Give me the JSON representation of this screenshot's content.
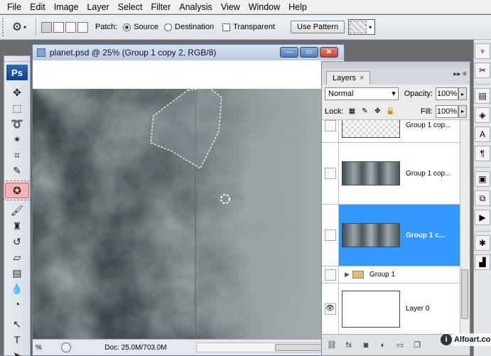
{
  "menu": [
    "File",
    "Edit",
    "Image",
    "Layer",
    "Select",
    "Filter",
    "Analysis",
    "View",
    "Window",
    "Help"
  ],
  "options_bar": {
    "patch_label": "Patch:",
    "source_label": "Source",
    "destination_label": "Destination",
    "transparent_label": "Transparent",
    "use_pattern_label": "Use Pattern",
    "selected_patch_mode": "Source"
  },
  "toolbox": {
    "logo": "Ps",
    "active_tool": "patch-tool"
  },
  "document": {
    "title": "planet.psd @ 25% (Group 1 copy 2, RGB/8)",
    "zoom_readout": "%",
    "doc_size": "Doc: 25.0M/703.0M"
  },
  "layers_panel": {
    "tab_label": "Layers",
    "blend_mode": "Normal",
    "opacity_label": "Opacity:",
    "opacity_value": "100%",
    "lock_label": "Lock:",
    "fill_label": "Fill:",
    "fill_value": "100%",
    "layers": [
      {
        "name": "Group 1 cop...",
        "visible": false,
        "selected": false
      },
      {
        "name": "Group 1 cop...",
        "visible": false,
        "selected": false
      },
      {
        "name": "Group 1 c...",
        "visible": true,
        "selected": true
      },
      {
        "name": "Group 1",
        "visible": false,
        "selected": false
      },
      {
        "name": "Layer 0",
        "visible": true,
        "selected": false
      }
    ]
  },
  "watermark": "Alfoart.com",
  "colors": {
    "selected_layer": "#3399ff",
    "active_tool_highlight": "#f6b3b3"
  }
}
